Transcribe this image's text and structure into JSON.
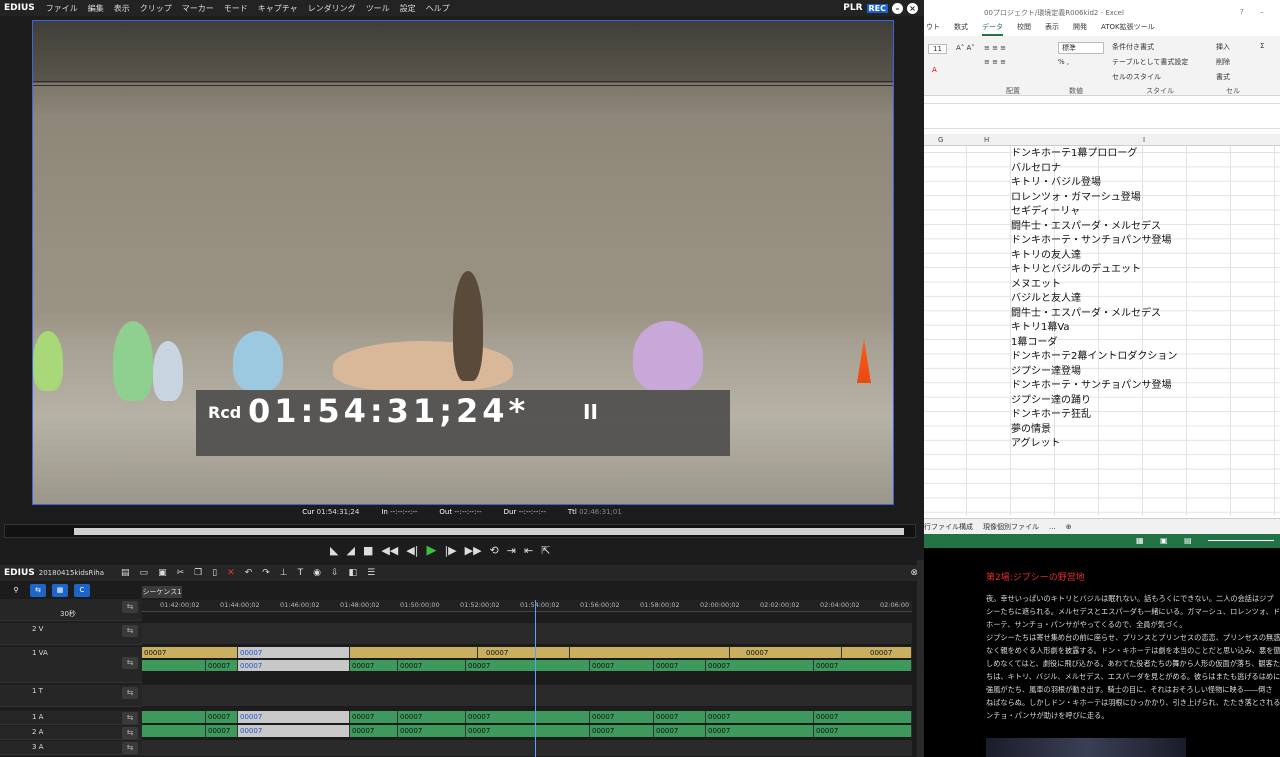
{
  "edius": {
    "logo": "EDIUS",
    "menu": [
      "ファイル",
      "編集",
      "表示",
      "クリップ",
      "マーカー",
      "モード",
      "キャプチャ",
      "レンダリング",
      "ツール",
      "設定",
      "ヘルプ"
    ],
    "plr": "PLR",
    "rec": "REC",
    "timecode": {
      "label": "Rcd",
      "value": "01:54:31;24*",
      "pause": "II"
    },
    "info": {
      "cur_label": "Cur",
      "cur": "01:54:31;24",
      "in_label": "In",
      "in": "--:--:--:--",
      "out_label": "Out",
      "out": "--:--:--:--",
      "dur_label": "Dur",
      "dur": "--:--:--:--",
      "ttl_label": "Ttl",
      "ttl": "02:46:31;01"
    },
    "timeline": {
      "logo": "EDIUS",
      "project": "20180415kidsRiha",
      "sequence_tab": "シーケンス1",
      "zoom": "30秒",
      "ruler": [
        "01:42:00;02",
        "01:44:00;02",
        "01:46:00;02",
        "01:48:00;02",
        "01:50:00;00",
        "01:52:00;02",
        "01:54:00;02",
        "01:56:00;02",
        "01:58:00;02",
        "02:00:00;02",
        "02:02:00;02",
        "02:04:00;02",
        "02:06:00"
      ],
      "tracks": [
        "2 V",
        "1 VA",
        "1 T",
        "1 A",
        "2 A",
        "3 A"
      ],
      "clip_label": "00007"
    }
  },
  "excel": {
    "title": "00プロジェクト/環境定義R006kid2 - Excel",
    "tabs": [
      "ウト",
      "数式",
      "データ",
      "校閲",
      "表示",
      "開発",
      "ATOK拡張ツール"
    ],
    "ribbon": {
      "font_size": "11",
      "number_format": "標準",
      "conditional": "条件付き書式",
      "table": "テーブルとして書式設定",
      "cell_style": "セルのスタイル",
      "insert": "挿入",
      "delete": "削除",
      "format": "書式"
    },
    "groups": [
      "配置",
      "数値",
      "スタイル",
      "セル"
    ],
    "columns": [
      "G",
      "H",
      "I"
    ],
    "cells": [
      "ドンキホーテ1幕プロローグ",
      "バルセロナ",
      "キトリ・バジル登場",
      "ロレンツォ・ガマーシュ登場",
      "セギディーリャ",
      "闘牛士・エスパーダ・メルセデス",
      "ドンキホーテ・サンチョパンサ登場",
      "キトリの友人達",
      "キトリとバジルのデュエット",
      "メヌエット",
      "バジルと友人達",
      "闘牛士・エスパーダ・メルセデス",
      "キトリ1幕Va",
      "1幕コーダ",
      "ドンキホーテ2幕イントロダクション",
      "ジプシー達登場",
      "ドンキホーテ・サンチョパンサ登場",
      "ジプシー達の踊り",
      "ドンキホーテ狂乱",
      "夢の情景",
      "アグレット"
    ],
    "sheets": [
      "行ファイル構成",
      "現像個別ファイル",
      "..."
    ]
  },
  "doc": {
    "heading": "第2場:ジプシーの野営地",
    "lines": [
      "夜。幸せいっぱいのキトリとバジルは眠れない。話もろくにできない。二人の会話はジプ",
      "シーたちに遮られる。メルセデスとエスパーダも一緒にいる。ガマーシュ、ロレンツォ、ドン・キ",
      "ホーテ、サンチョ・パンサがやってくるので、全員が気づく。",
      "ジプシーたちは寄せ集め台の前に座らせ、プリンスとプリンセスの恋恋、プリンセスの無惑恋",
      "なく親をめぐる人形劇を披露する。ドン・キホーテは劇を本当のことだと思い込み、悪を懲ら",
      "しめなくてはと、劇役に飛び込かる。あわてた役者たちの舞から人形の仮面が落ち、観客た",
      "ちは、キトリ、バジル、メルセデス、エスパーダを見とがめる。彼らはまたも逃げるはめに。",
      "強風がたち、風車の羽根が動き出す。騎士の目に、それはおそろしい怪物に映る――倒さ",
      "ねばならぬ。しかしドン・キホーテは羽根にひっかかり、引き上げられ、たたき落とされる。サ",
      "ンチョ・パンサが助けを呼びに走る。"
    ]
  }
}
